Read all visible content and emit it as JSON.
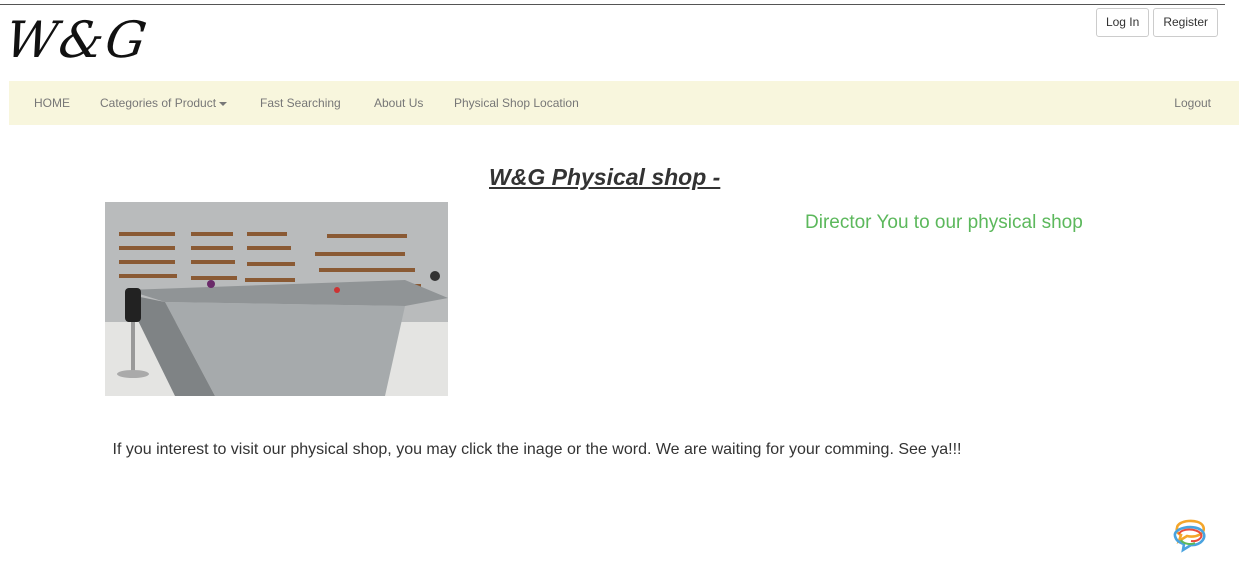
{
  "header": {
    "logo": "W&G",
    "auth": {
      "login": "Log In",
      "register": "Register"
    }
  },
  "nav": {
    "home": "HOME",
    "categories": "Categories of Product",
    "fast_search": "Fast Searching",
    "about": "About Us",
    "shop_location": "Physical Shop Location",
    "logout": "Logout"
  },
  "main": {
    "headline": "W&G Physical shop -",
    "director_link": "Director You to our physical shop",
    "intro": "If you interest to visit our physical shop, you may click the inage or the word. We are waiting for your comming. See ya!!!"
  },
  "colors": {
    "navbar_bg": "#f8f6dd",
    "accent_green": "#5cb85c",
    "nav_text": "#777777"
  },
  "icons": {
    "chat": "chat-bubbles-icon",
    "dropdown": "caret-down-icon"
  }
}
